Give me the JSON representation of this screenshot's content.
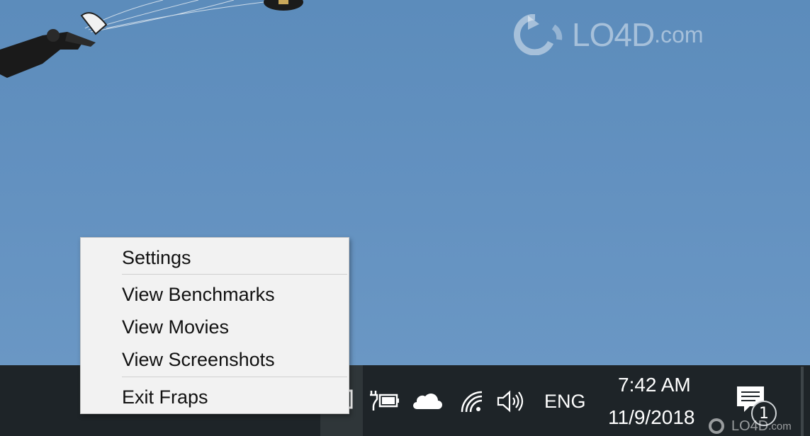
{
  "watermark": {
    "brand": "LO4D",
    "domain": ".com"
  },
  "context_menu": {
    "items": [
      {
        "label": "Settings"
      },
      {
        "label": "View Benchmarks"
      },
      {
        "label": "View Movies"
      },
      {
        "label": "View Screenshots"
      },
      {
        "label": "Exit Fraps"
      }
    ]
  },
  "taskbar": {
    "tray_icons": [
      "power-plug-battery-icon",
      "onedrive-cloud-icon",
      "wifi-icon",
      "volume-icon"
    ],
    "language": "ENG",
    "clock": {
      "time": "7:42 AM",
      "date": "11/9/2018"
    },
    "notifications": {
      "icon": "action-center-icon",
      "count": "1"
    }
  }
}
